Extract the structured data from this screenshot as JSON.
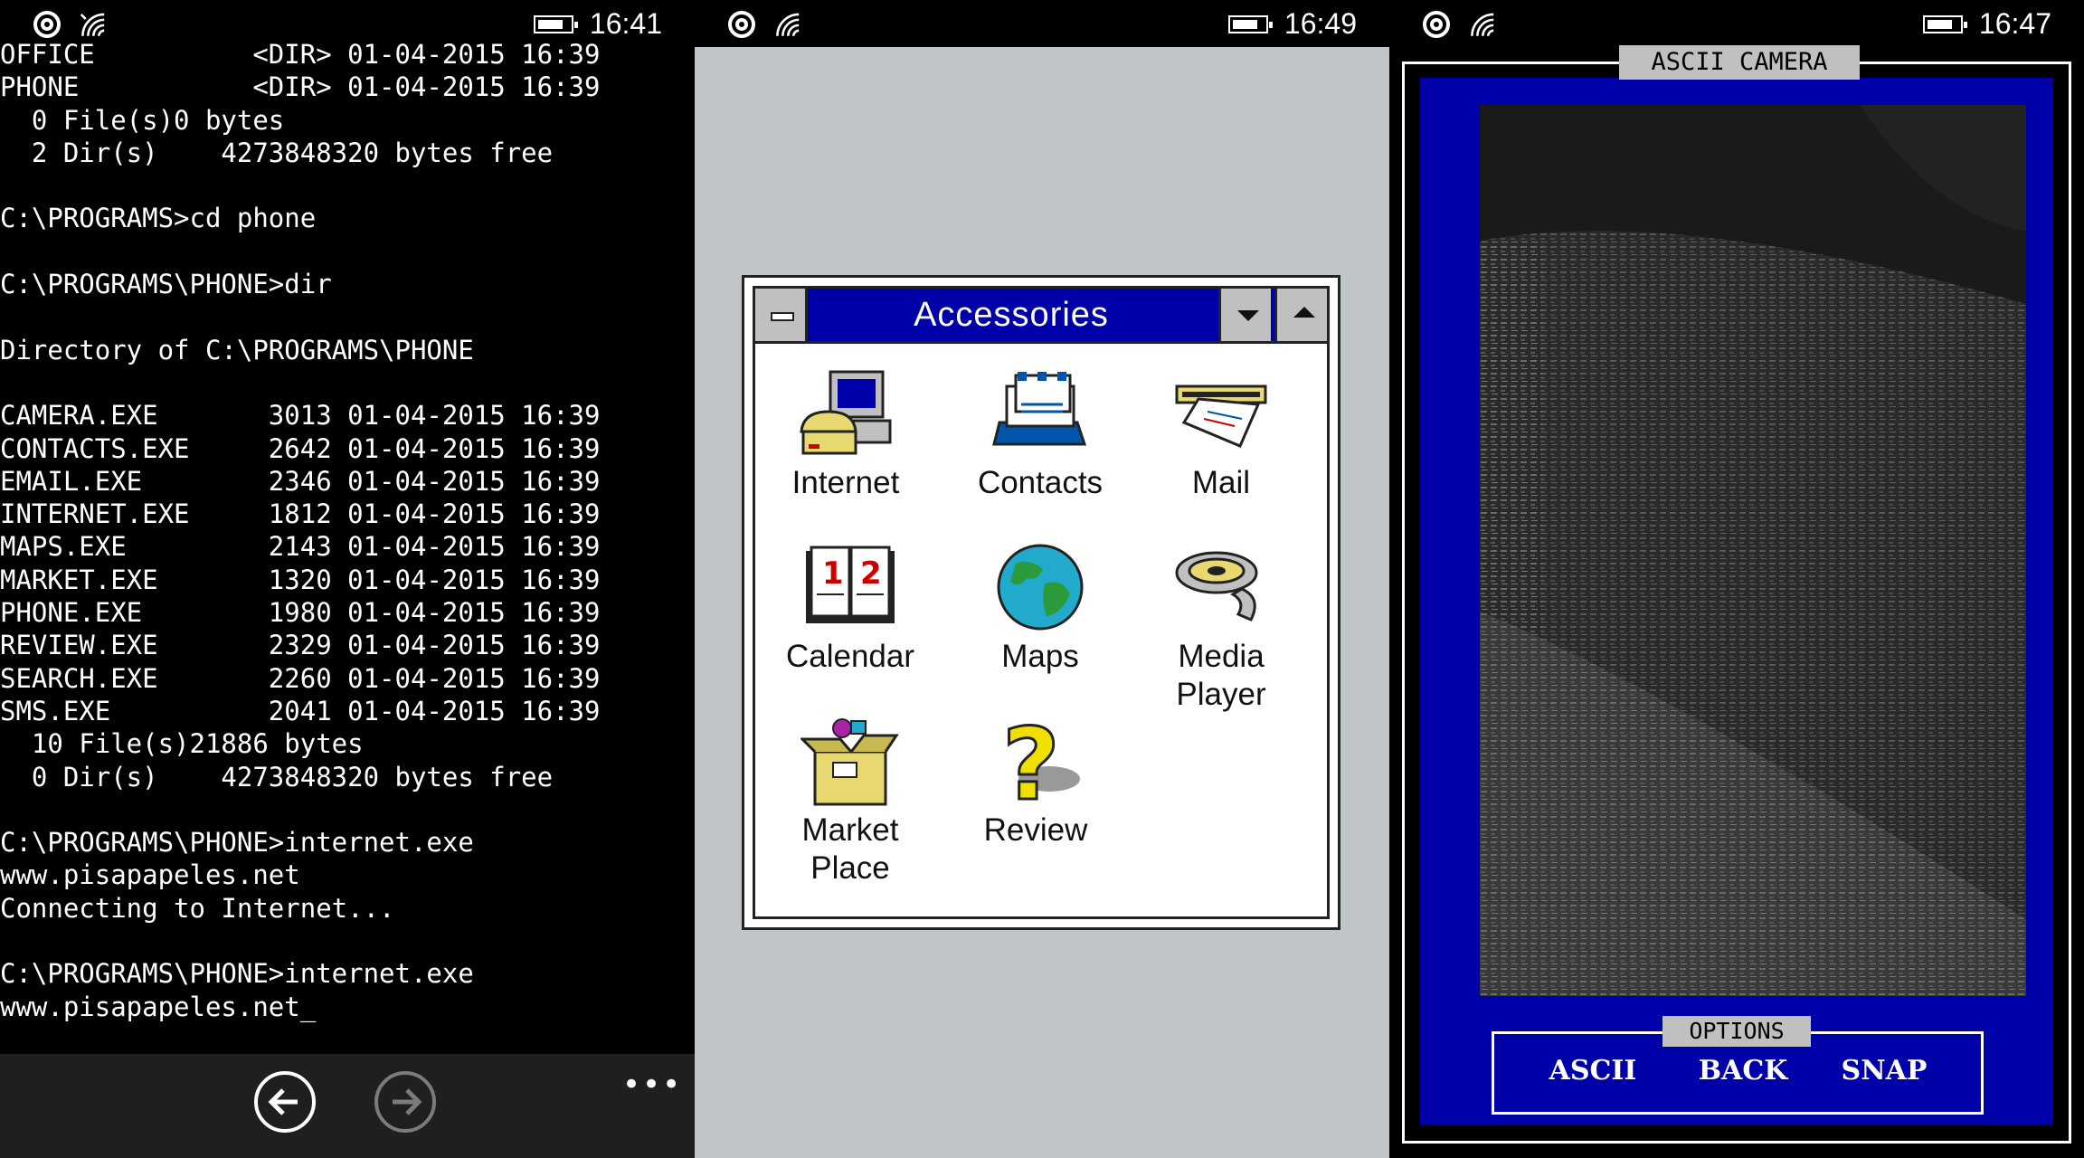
{
  "panels": [
    {
      "status": {
        "time": "16:41"
      }
    },
    {
      "status": {
        "time": "16:49"
      }
    },
    {
      "status": {
        "time": "16:47"
      }
    }
  ],
  "console": {
    "lines": [
      "OFFICE          <DIR> 01-04-2015 16:39",
      "PHONE           <DIR> 01-04-2015 16:39",
      "  0 File(s)0 bytes",
      "  2 Dir(s)    4273848320 bytes free",
      "",
      "C:\\PROGRAMS>cd phone",
      "",
      "C:\\PROGRAMS\\PHONE>dir",
      "",
      "Directory of C:\\PROGRAMS\\PHONE",
      "",
      "CAMERA.EXE       3013 01-04-2015 16:39",
      "CONTACTS.EXE     2642 01-04-2015 16:39",
      "EMAIL.EXE        2346 01-04-2015 16:39",
      "INTERNET.EXE     1812 01-04-2015 16:39",
      "MAPS.EXE         2143 01-04-2015 16:39",
      "MARKET.EXE       1320 01-04-2015 16:39",
      "PHONE.EXE        1980 01-04-2015 16:39",
      "REVIEW.EXE       2329 01-04-2015 16:39",
      "SEARCH.EXE       2260 01-04-2015 16:39",
      "SMS.EXE          2041 01-04-2015 16:39",
      "  10 File(s)21886 bytes",
      "  0 Dir(s)    4273848320 bytes free",
      "",
      "C:\\PROGRAMS\\PHONE>internet.exe",
      "www.pisapapeles.net",
      "Connecting to Internet...",
      "",
      "C:\\PROGRAMS\\PHONE>internet.exe",
      "www.pisapapeles.net_"
    ],
    "appbar": {
      "more": "•••"
    }
  },
  "accessories": {
    "title": "Accessories",
    "icons": [
      {
        "label": "Internet"
      },
      {
        "label": "Contacts"
      },
      {
        "label": "Mail"
      },
      {
        "label": "Calendar"
      },
      {
        "label": "Maps"
      },
      {
        "label": "Media\nPlayer"
      },
      {
        "label": "Market\nPlace"
      },
      {
        "label": "Review"
      }
    ]
  },
  "camera": {
    "title": "ASCII CAMERA",
    "options_label": "OPTIONS",
    "buttons": [
      "ASCII",
      "BACK",
      "SNAP"
    ]
  },
  "colors": {
    "win_title": "#0000a8",
    "desktop": "#c0c5c8",
    "console_bg": "#000000"
  }
}
